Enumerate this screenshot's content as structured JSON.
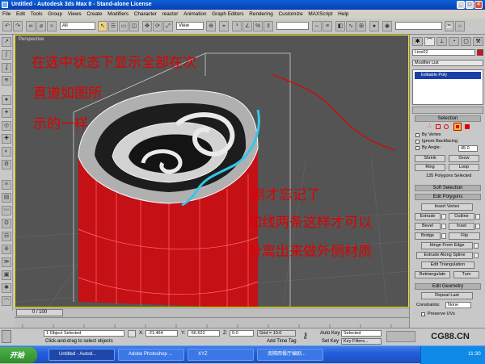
{
  "window": {
    "title": "Untitled - Autodesk 3ds Max 8  - Stand-alone License"
  },
  "menu": [
    "File",
    "Edit",
    "Tools",
    "Group",
    "Views",
    "Create",
    "Modifiers",
    "Character",
    "reactor",
    "Animation",
    "Graph Editors",
    "Rendering",
    "Customize",
    "MAXScript",
    "Help"
  ],
  "toolbar": {
    "selection_filter": "All",
    "ref_coord": "View"
  },
  "viewport": {
    "label": "Perspective"
  },
  "annotations": {
    "line1": "在选中状态下显示全部在次",
    "line2": "直道如图所",
    "line3": "示的一样",
    "line4": "刚才忘记了",
    "line5": "加线两条这样才可以",
    "line6": "分离出来做外侧材质"
  },
  "timeline": {
    "slider": "0 / 100"
  },
  "status": {
    "selected": "1 Object Selected",
    "prompt": "Click-and-drag to select objects",
    "x_label": "X:",
    "x_value": "-21.464",
    "y_label": "Y:",
    "y_value": "-56.622",
    "z_label": "Z:",
    "z_value": "0.0",
    "grid": "Grid = 10.0",
    "add_time_tag": "Add Time Tag",
    "auto_key": "Auto Key",
    "auto_key_value": "Selected",
    "set_key": "Set Key",
    "key_filters": "Key Filters..."
  },
  "panel": {
    "object_name": "Line02",
    "modifier_list": "Modifier List",
    "stack_item": "Editable Poly",
    "selection_header": "Selection",
    "by_vertex": "By Vertex",
    "ignore_backfacing": "Ignore Backfacing",
    "by_angle": "By Angle:",
    "by_angle_value": "45.0",
    "shrink": "Shrink",
    "grow": "Grow",
    "ring": "Ring",
    "loop": "Loop",
    "selected_count": "135 Polygons Selected",
    "soft_selection": "Soft Selection",
    "edit_polygons": "Edit Polygons",
    "insert_vertex": "Insert Vertex",
    "extrude": "Extrude",
    "outline": "Outline",
    "bevel": "Bevel",
    "inset": "Inset",
    "bridge": "Bridge",
    "flip": "Flip",
    "hinge_from_edge": "Hinge From Edge",
    "extrude_along_spline": "Extrude Along Spline",
    "edit_triangulation": "Edit Triangulation",
    "retriangulate": "Retriangulate",
    "turn": "Turn",
    "edit_geometry": "Edit Geometry",
    "repeat_last": "Repeat Last",
    "constraints": "Constraints:",
    "constraints_value": "None",
    "preserve_uvs": "Preserve UVs"
  },
  "taskbar": {
    "start": "开始",
    "items": [
      "Untitled - Autod...",
      "Adobe Photoshop ...",
      "XYZ",
      "南隔西餐厅编剧..."
    ],
    "clock": "11:30"
  },
  "watermark": "CG88.CN",
  "colors": {
    "title_blue": "#0a47c4",
    "viewport_bg": "#545454",
    "selection_red": "#d0141a",
    "highlight_cyan": "#33c7e8",
    "annotation_red": "#e00000"
  }
}
